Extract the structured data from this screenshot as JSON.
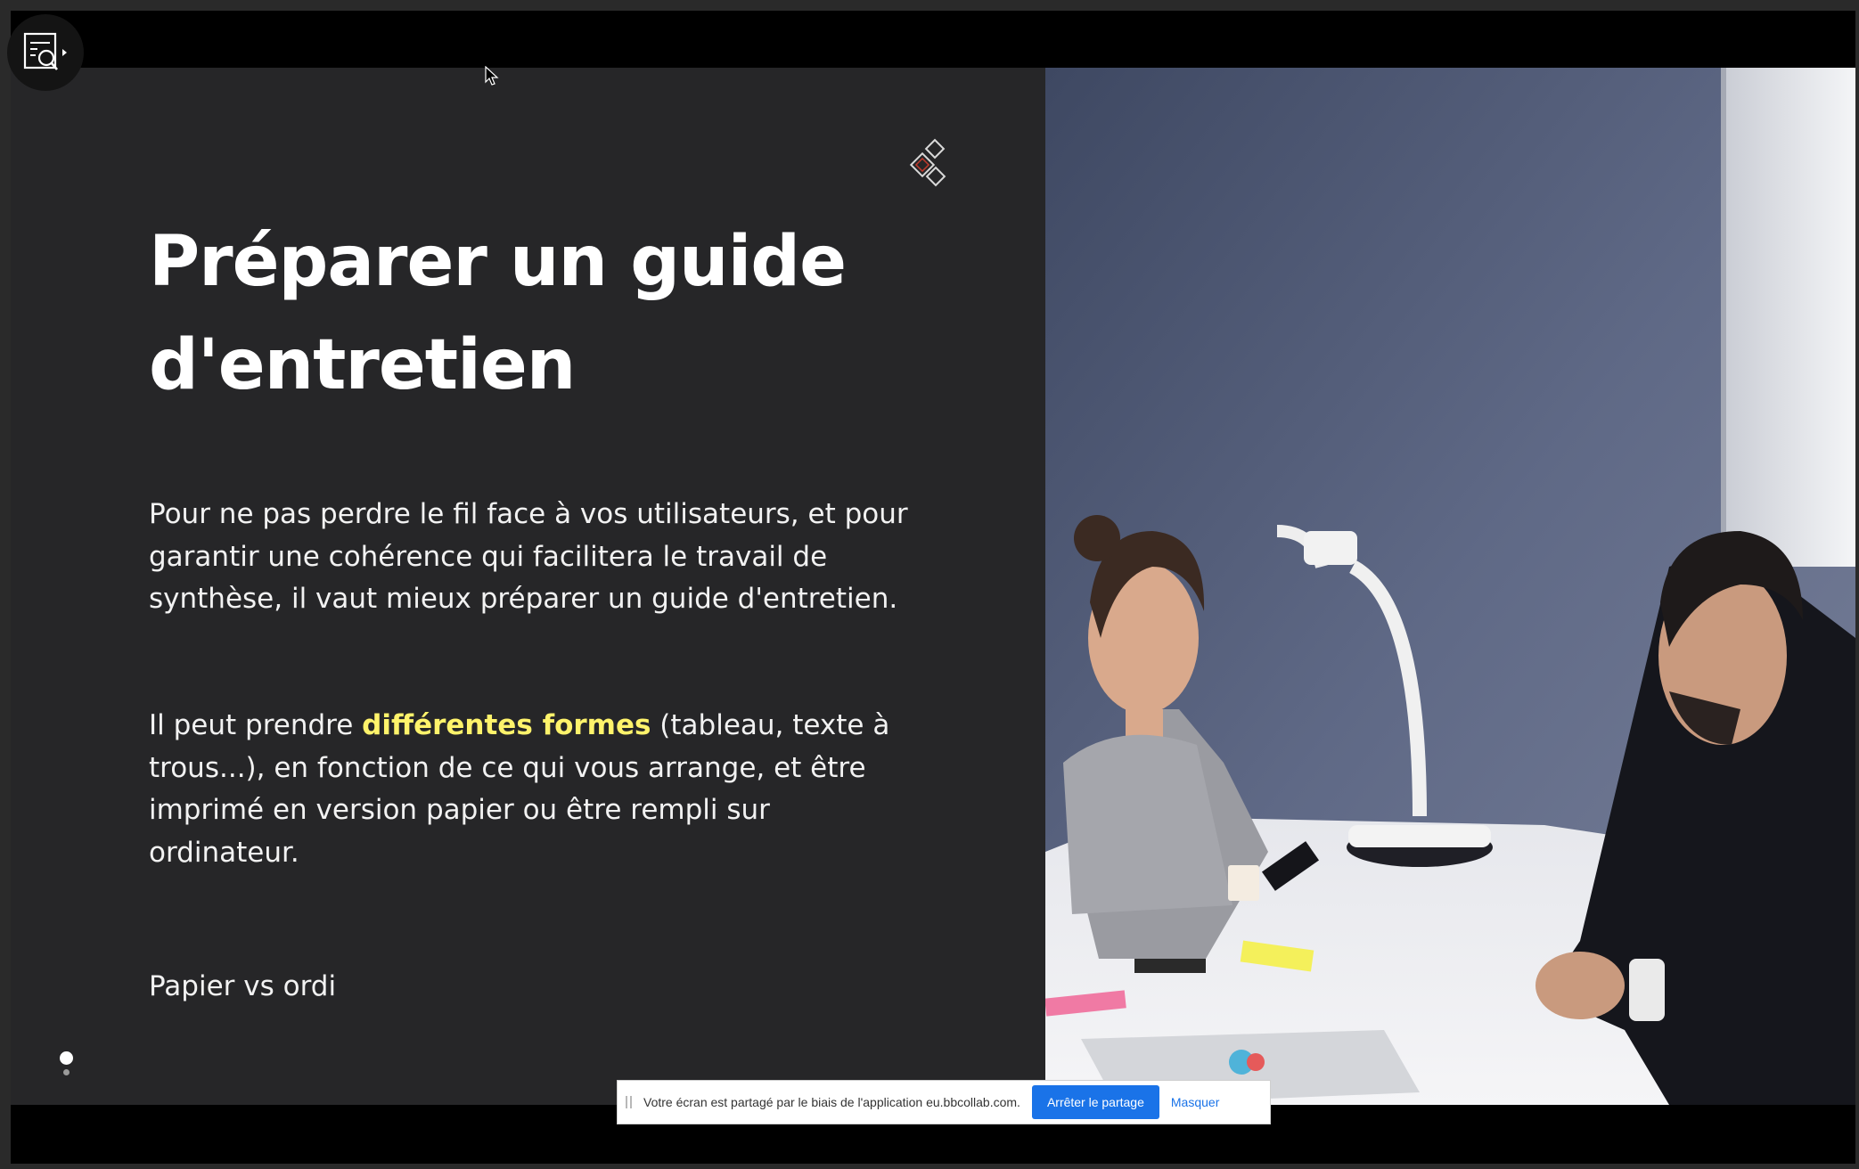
{
  "slide": {
    "title_line1": "Préparer un guide",
    "title_line2": "d'entretien",
    "paragraph1": "Pour ne pas perdre le fil face à vos utilisateurs, et pour garantir une cohérence qui facilitera le travail de synthèse, il vaut mieux préparer un guide d'entretien.",
    "paragraph2_before": "Il peut prendre ",
    "paragraph2_highlight": "différentes formes",
    "paragraph2_after": " (tableau, texte à trous...), en fonction de ce qui vous arrange, et être imprimé en version papier ou être rempli sur ordinateur.",
    "paragraph3": "Papier vs ordi",
    "highlight_color": "#fff36b",
    "image_description": "two-people-interview-photo"
  },
  "toolbar": {
    "tool_icon": "search-document-icon"
  },
  "share_banner": {
    "message": "Votre écran est partagé par le biais de l'application eu.bbcollab.com.",
    "stop_label": "Arrêter le partage",
    "hide_label": "Masquer",
    "accent_color": "#1a73e8"
  }
}
